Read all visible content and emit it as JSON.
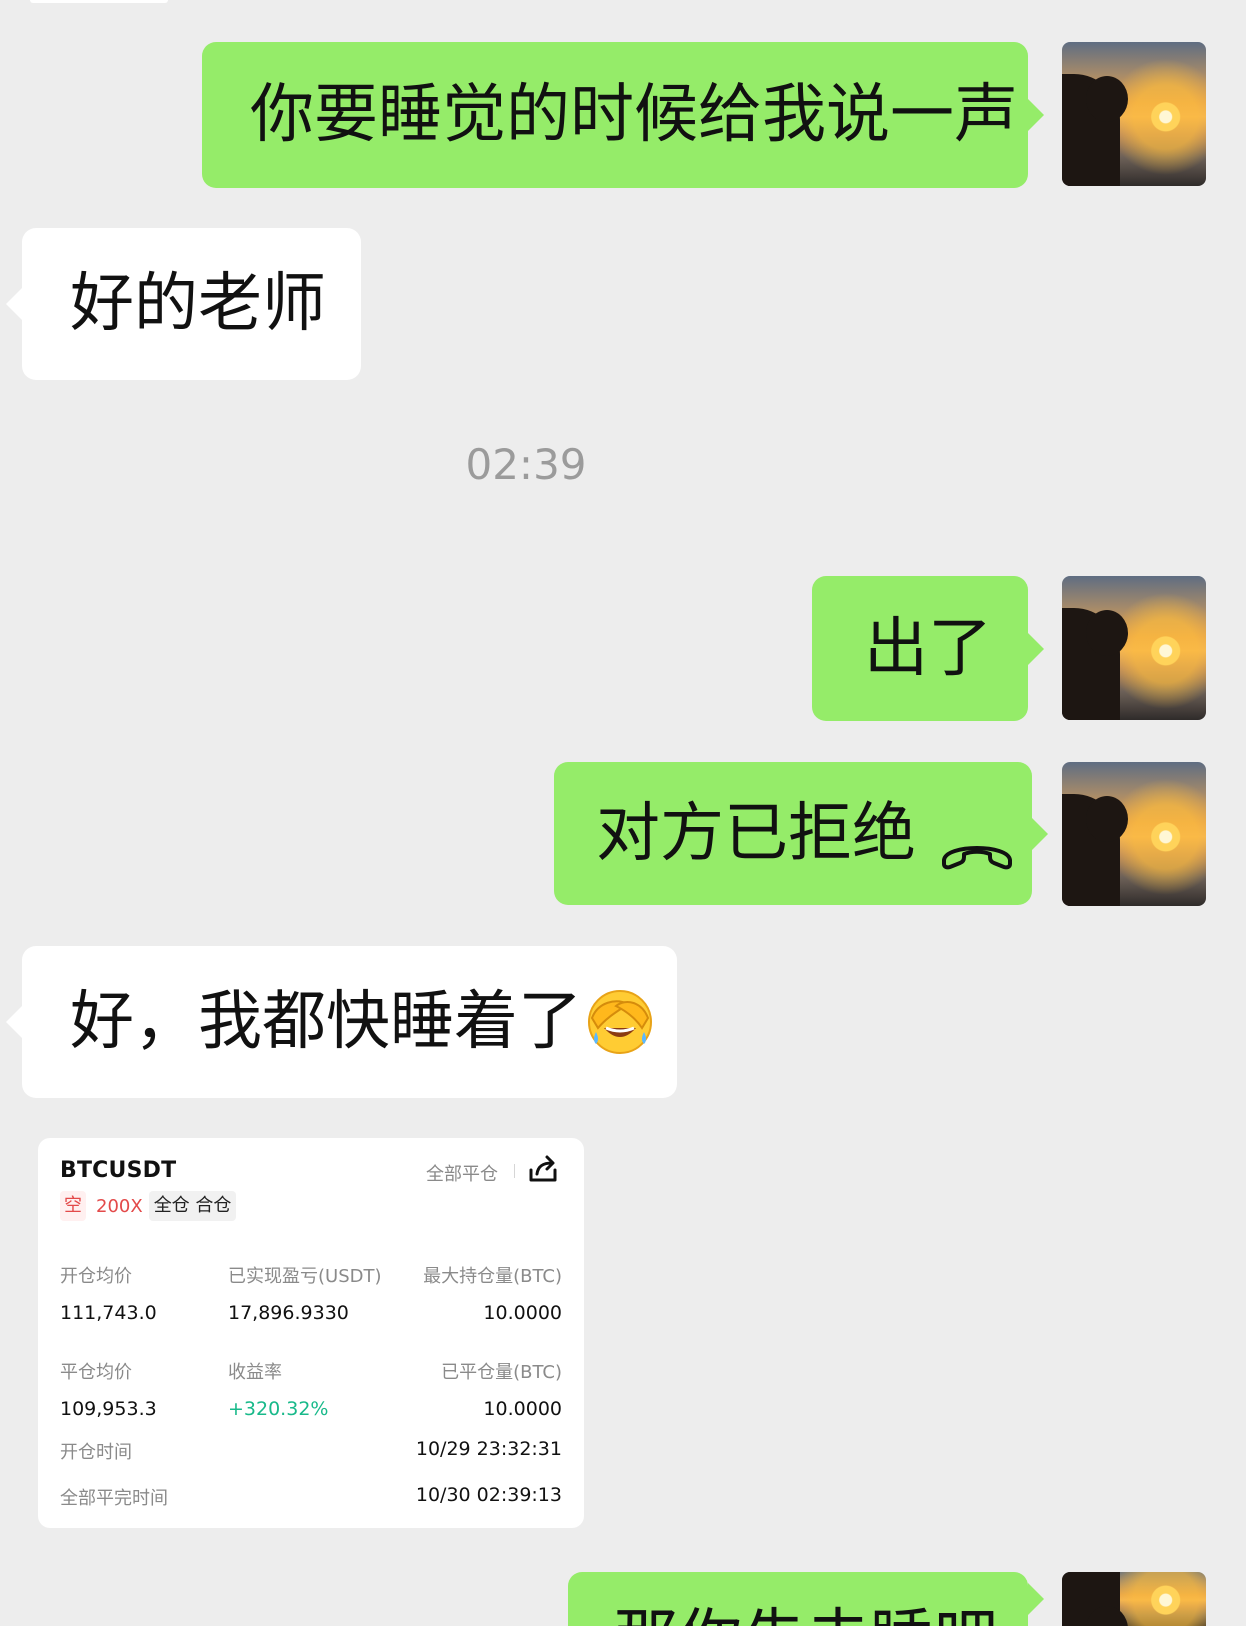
{
  "messages": [
    {
      "id": "m1",
      "text": "你要睡觉的时候给我说一声"
    },
    {
      "id": "m2",
      "text": "好的老师"
    },
    {
      "id": "m3",
      "text": "出了"
    },
    {
      "id": "m4",
      "text": "对方已拒绝"
    },
    {
      "id": "m5",
      "text": "好，我都快睡着了"
    },
    {
      "id": "m6",
      "text": "那你先去睡吧"
    }
  ],
  "timestamp": "02:39",
  "icons": {
    "hangup": "phone-hangup-icon",
    "emoji": "facepalm-laughing-emoji",
    "share": "share-icon",
    "avatar": "sunset-silhouette-avatar"
  },
  "colors": {
    "background": "#ededed",
    "outgoing_bubble": "#95ec69",
    "incoming_bubble": "#ffffff",
    "timestamp_text": "#9b9b9b",
    "short_red": "#e34a4a",
    "profit_green": "#18b98a"
  },
  "trade_card": {
    "symbol": "BTCUSDT",
    "close_all_label": "全部平仓",
    "side": "空",
    "leverage": "200X",
    "margin_mode": "全仓 合仓",
    "entry_price_label": "开仓均价",
    "entry_price": "111,743.0",
    "realized_pnl_label": "已实现盈亏(USDT)",
    "realized_pnl": "17,896.9330",
    "max_position_label": "最大持仓量(BTC)",
    "max_position": "10.0000",
    "exit_price_label": "平仓均价",
    "exit_price": "109,953.3",
    "return_label": "收益率",
    "return_value": "+320.32%",
    "closed_qty_label": "已平仓量(BTC)",
    "closed_qty": "10.0000",
    "open_time_label": "开仓时间",
    "open_time": "10/29 23:32:31",
    "close_time_label": "全部平完时间",
    "close_time": "10/30 02:39:13"
  }
}
